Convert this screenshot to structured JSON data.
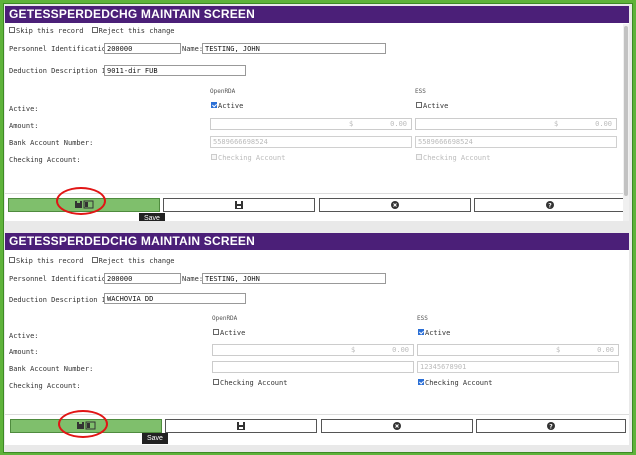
{
  "screens": [
    {
      "title": "GETESSPERDEDCHG MAINTAIN SCREEN",
      "skip_label": "Skip this record",
      "reject_label": "Reject this change",
      "personnel_label": "Personnel Identification:",
      "personnel_value": "200000",
      "name_label": "Name:",
      "name_value": "TESTING, JOHN",
      "deduction_label": "Deduction Description ID:",
      "deduction_value": "9011-dir FUB",
      "col_openrda": "OpenRDA",
      "col_ess": "ESS",
      "active_label": "Active:",
      "active_text": "Active",
      "active_openrda": true,
      "active_ess": false,
      "amount_label": "Amount:",
      "amount_openrda": "0.00",
      "amount_ess": "0.00",
      "currency_symbol": "$",
      "bank_label": "Bank Account Number:",
      "bank_openrda": "5589666698524",
      "bank_ess": "5589666698524",
      "checking_label": "Checking Account:",
      "checking_text": "Checking Account",
      "checking_openrda": false,
      "checking_ess": false,
      "save_tooltip": "Save"
    },
    {
      "title": "GETESSPERDEDCHG MAINTAIN SCREEN",
      "skip_label": "Skip this record",
      "reject_label": "Reject this change",
      "personnel_label": "Personnel Identification:",
      "personnel_value": "200000",
      "name_label": "Name:",
      "name_value": "TESTING, JOHN",
      "deduction_label": "Deduction Description ID:",
      "deduction_value": "WACHOVIA DD",
      "col_openrda": "OpenRDA",
      "col_ess": "ESS",
      "active_label": "Active:",
      "active_text": "Active",
      "active_openrda": false,
      "active_ess": true,
      "amount_label": "Amount:",
      "amount_openrda": "0.00",
      "amount_ess": "0.00",
      "currency_symbol": "$",
      "bank_label": "Bank Account Number:",
      "bank_openrda": "",
      "bank_ess": "12345678901",
      "checking_label": "Checking Account:",
      "checking_text": "Checking Account",
      "checking_openrda": false,
      "checking_ess": true,
      "save_tooltip": "Save"
    }
  ],
  "icons": {
    "save_all": "save-records-icon",
    "save": "floppy-disk-icon",
    "cancel": "close-circle-icon",
    "help": "question-circle-icon"
  },
  "colors": {
    "title_bar": "#4b1f78",
    "save_button": "#7fbf6c",
    "highlight_circle": "#e11515",
    "frame": "#5eb33a"
  }
}
